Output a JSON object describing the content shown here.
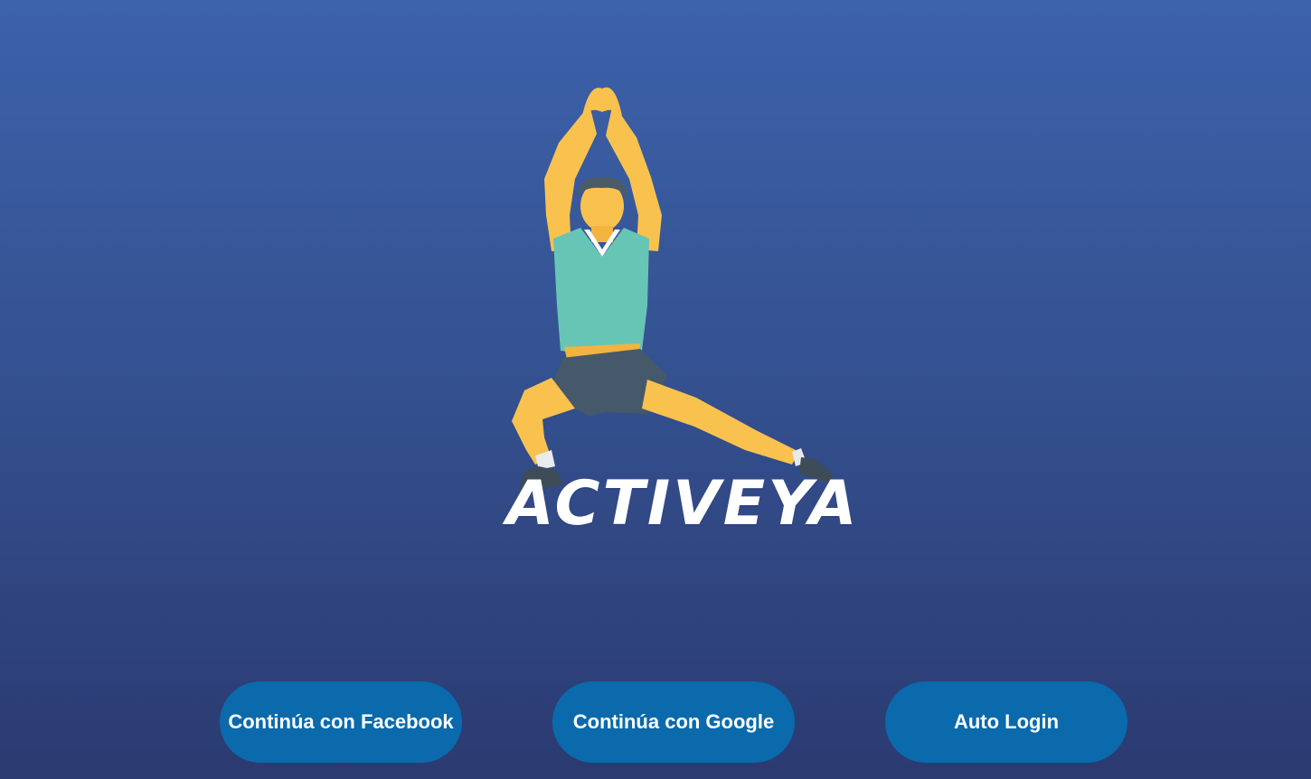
{
  "brand": {
    "name": "ACTIVEYA",
    "logo_icon": "stretching-man-icon"
  },
  "actions": {
    "facebook_label": "Continúa con Facebook",
    "google_label": "Continúa con Google",
    "auto_login_label": "Auto Login"
  },
  "colors": {
    "background_top": "#3c62ab",
    "background_bottom": "#2b3a71",
    "button": "#0a6aab",
    "button_text": "#ffffff",
    "brand_text": "#ffffff"
  }
}
